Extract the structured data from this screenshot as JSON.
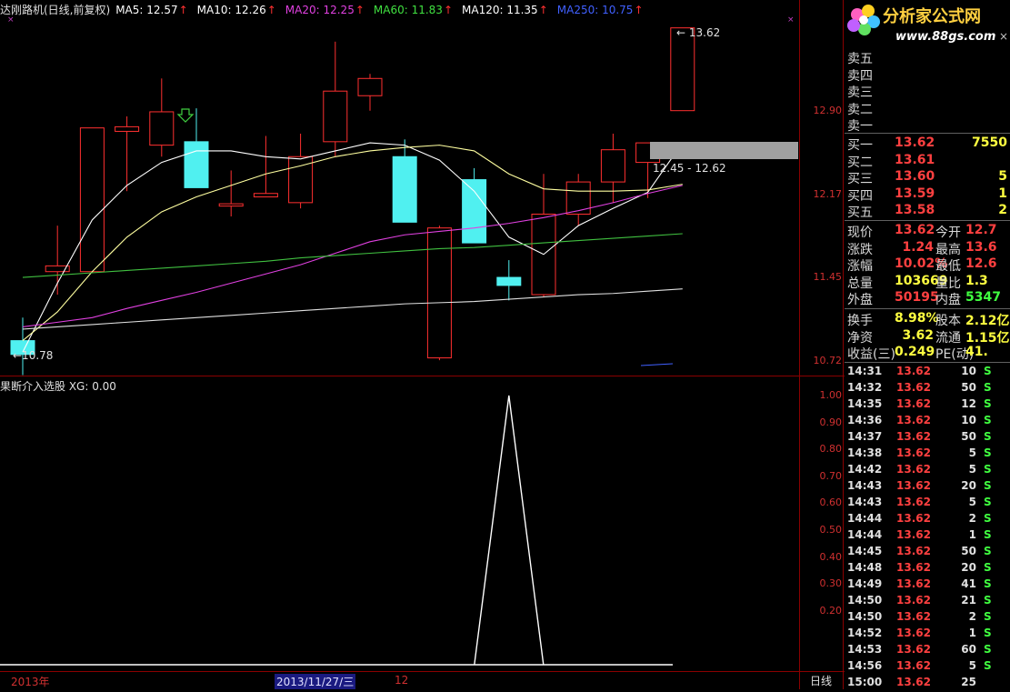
{
  "header": {
    "title": "达刚路机(日线,前复权)",
    "ma": [
      {
        "label": "MA5: 12.57",
        "color": "#ffffff"
      },
      {
        "label": "MA10: 12.26",
        "color": "#ffffff"
      },
      {
        "label": "MA20: 12.25",
        "color": "#e040e0"
      },
      {
        "label": "MA60: 11.83",
        "color": "#40e040"
      },
      {
        "label": "MA120: 11.35",
        "color": "#ffffff"
      },
      {
        "label": "MA250: 10.75",
        "color": "#4060ff"
      }
    ],
    "up_arrow": "↑"
  },
  "chart_data": {
    "type": "candlestick",
    "price_axis": [
      "12.90",
      "12.17",
      "11.45",
      "10.72"
    ],
    "max_label": "13.62",
    "min_label": "10.78",
    "range_label": "12.45 - 12.62",
    "candles": [
      {
        "o": 10.9,
        "c": 10.78,
        "h": 11.1,
        "l": 10.6
      },
      {
        "o": 11.5,
        "c": 11.55,
        "h": 11.9,
        "l": 11.3
      },
      {
        "o": 11.5,
        "c": 12.75,
        "h": 12.75,
        "l": 11.5
      },
      {
        "o": 12.72,
        "c": 12.76,
        "h": 12.85,
        "l": 12.2
      },
      {
        "o": 12.6,
        "c": 12.89,
        "h": 13.18,
        "l": 12.5
      },
      {
        "o": 12.63,
        "c": 12.23,
        "h": 12.92,
        "l": 12.23
      },
      {
        "o": 12.07,
        "c": 12.09,
        "h": 12.38,
        "l": 11.98
      },
      {
        "o": 12.15,
        "c": 12.18,
        "h": 12.68,
        "l": 12.15
      },
      {
        "o": 12.1,
        "c": 12.5,
        "h": 12.7,
        "l": 12.05
      },
      {
        "o": 12.63,
        "c": 13.07,
        "h": 13.5,
        "l": 12.5
      },
      {
        "o": 13.03,
        "c": 13.18,
        "h": 13.22,
        "l": 12.9
      },
      {
        "o": 12.5,
        "c": 11.93,
        "h": 12.65,
        "l": 11.93
      },
      {
        "o": 10.75,
        "c": 11.88,
        "h": 11.9,
        "l": 10.73
      },
      {
        "o": 12.3,
        "c": 11.75,
        "h": 12.4,
        "l": 11.75
      },
      {
        "o": 11.45,
        "c": 11.38,
        "h": 11.6,
        "l": 11.25
      },
      {
        "o": 11.3,
        "c": 12.0,
        "h": 12.35,
        "l": 11.28
      },
      {
        "o": 12.0,
        "c": 12.28,
        "h": 12.35,
        "l": 11.9
      },
      {
        "o": 12.28,
        "c": 12.56,
        "h": 12.7,
        "l": 12.1
      },
      {
        "o": 12.45,
        "c": 12.62,
        "h": 12.62,
        "l": 12.14
      },
      {
        "o": 12.9,
        "c": 13.62,
        "h": 13.62,
        "l": 12.9
      }
    ],
    "ma5": [
      10.8,
      11.4,
      11.95,
      12.25,
      12.45,
      12.55,
      12.55,
      12.5,
      12.48,
      12.55,
      12.62,
      12.6,
      12.47,
      12.2,
      11.8,
      11.65,
      11.9,
      12.05,
      12.19,
      12.62
    ],
    "ma10": [
      10.9,
      11.15,
      11.5,
      11.8,
      12.02,
      12.15,
      12.25,
      12.35,
      12.42,
      12.5,
      12.55,
      12.58,
      12.6,
      12.55,
      12.35,
      12.22,
      12.2,
      12.2,
      12.21,
      12.26
    ],
    "ma20": [
      11.02,
      11.06,
      11.1,
      11.18,
      11.25,
      11.32,
      11.4,
      11.48,
      11.56,
      11.66,
      11.76,
      11.82,
      11.85,
      11.88,
      11.92,
      11.97,
      12.03,
      12.1,
      12.18,
      12.25
    ],
    "ma60": [
      11.45,
      11.47,
      11.49,
      11.51,
      11.53,
      11.55,
      11.57,
      11.59,
      11.62,
      11.64,
      11.66,
      11.68,
      11.7,
      11.71,
      11.73,
      11.75,
      11.77,
      11.79,
      11.81,
      11.83
    ],
    "ma120": [
      11.0,
      11.02,
      11.04,
      11.06,
      11.08,
      11.1,
      11.12,
      11.14,
      11.16,
      11.18,
      11.2,
      11.22,
      11.23,
      11.24,
      11.26,
      11.28,
      11.3,
      11.31,
      11.33,
      11.35
    ],
    "ymin": 10.62,
    "ymax": 13.72,
    "indicator": {
      "title": "果断介入选股 XG: 0.00",
      "axis": [
        "1.00",
        "0.90",
        "0.80",
        "0.70",
        "0.60",
        "0.50",
        "0.40",
        "0.30",
        "0.20"
      ],
      "values": [
        0,
        0,
        0,
        0,
        0,
        0,
        0,
        0,
        0,
        0,
        0,
        0,
        0,
        0,
        1,
        0,
        0,
        0,
        0,
        0
      ]
    },
    "dates": {
      "year": "2013年",
      "selected": "2013/11/27/三",
      "month": "12",
      "period": "日线"
    }
  },
  "panel": {
    "logo_text": "分析家公式网",
    "logo_url": "www.88gs.com",
    "asks": [
      {
        "label": "卖五",
        "price": "",
        "vol": ""
      },
      {
        "label": "卖四",
        "price": "",
        "vol": ""
      },
      {
        "label": "卖三",
        "price": "",
        "vol": ""
      },
      {
        "label": "卖二",
        "price": "",
        "vol": ""
      },
      {
        "label": "卖一",
        "price": "",
        "vol": ""
      }
    ],
    "bids": [
      {
        "label": "买一",
        "price": "13.62",
        "vol": "7550"
      },
      {
        "label": "买二",
        "price": "13.61",
        "vol": ""
      },
      {
        "label": "买三",
        "price": "13.60",
        "vol": "5"
      },
      {
        "label": "买四",
        "price": "13.59",
        "vol": "1"
      },
      {
        "label": "买五",
        "price": "13.58",
        "vol": "2"
      }
    ],
    "stats": [
      {
        "l1": "现价",
        "v1": "13.62",
        "c1": "#ff4040",
        "l2": "今开",
        "v2": "12.7",
        "c2": "#ff4040"
      },
      {
        "l1": "涨跌",
        "v1": "1.24",
        "c1": "#ff4040",
        "l2": "最高",
        "v2": "13.6",
        "c2": "#ff4040"
      },
      {
        "l1": "涨幅",
        "v1": "10.02%",
        "c1": "#ff4040",
        "l2": "最低",
        "v2": "12.6",
        "c2": "#ff4040"
      },
      {
        "l1": "总量",
        "v1": "103669",
        "c1": "#ffff40",
        "l2": "量比",
        "v2": "1.3",
        "c2": "#ffff40"
      },
      {
        "l1": "外盘",
        "v1": "50195",
        "c1": "#ff4040",
        "l2": "内盘",
        "v2": "5347",
        "c2": "#40ff40"
      }
    ],
    "stats2": [
      {
        "l1": "换手",
        "v1": "8.98%",
        "c1": "#ffff40",
        "l2": "股本",
        "v2": "2.12亿",
        "c2": "#ffff40"
      },
      {
        "l1": "净资",
        "v1": "3.62",
        "c1": "#ffff40",
        "l2": "流通",
        "v2": "1.15亿",
        "c2": "#ffff40"
      },
      {
        "l1": "收益(三)",
        "v1": "0.249",
        "c1": "#ffff40",
        "l2": "PE(动)",
        "v2": "41.",
        "c2": "#ffff40"
      }
    ],
    "ticks": [
      {
        "t": "14:31",
        "p": "13.62",
        "v": "10",
        "s": "S"
      },
      {
        "t": "14:32",
        "p": "13.62",
        "v": "50",
        "s": "S"
      },
      {
        "t": "14:35",
        "p": "13.62",
        "v": "12",
        "s": "S"
      },
      {
        "t": "14:36",
        "p": "13.62",
        "v": "10",
        "s": "S"
      },
      {
        "t": "14:37",
        "p": "13.62",
        "v": "50",
        "s": "S"
      },
      {
        "t": "14:38",
        "p": "13.62",
        "v": "5",
        "s": "S"
      },
      {
        "t": "14:42",
        "p": "13.62",
        "v": "5",
        "s": "S"
      },
      {
        "t": "14:43",
        "p": "13.62",
        "v": "20",
        "s": "S"
      },
      {
        "t": "14:43",
        "p": "13.62",
        "v": "5",
        "s": "S"
      },
      {
        "t": "14:44",
        "p": "13.62",
        "v": "2",
        "s": "S"
      },
      {
        "t": "14:44",
        "p": "13.62",
        "v": "1",
        "s": "S"
      },
      {
        "t": "14:45",
        "p": "13.62",
        "v": "50",
        "s": "S"
      },
      {
        "t": "14:48",
        "p": "13.62",
        "v": "20",
        "s": "S"
      },
      {
        "t": "14:49",
        "p": "13.62",
        "v": "41",
        "s": "S"
      },
      {
        "t": "14:50",
        "p": "13.62",
        "v": "21",
        "s": "S"
      },
      {
        "t": "14:50",
        "p": "13.62",
        "v": "2",
        "s": "S"
      },
      {
        "t": "14:52",
        "p": "13.62",
        "v": "1",
        "s": "S"
      },
      {
        "t": "14:53",
        "p": "13.62",
        "v": "60",
        "s": "S"
      },
      {
        "t": "14:56",
        "p": "13.62",
        "v": "5",
        "s": "S"
      },
      {
        "t": "15:00",
        "p": "13.62",
        "v": "25",
        "s": ""
      }
    ]
  }
}
